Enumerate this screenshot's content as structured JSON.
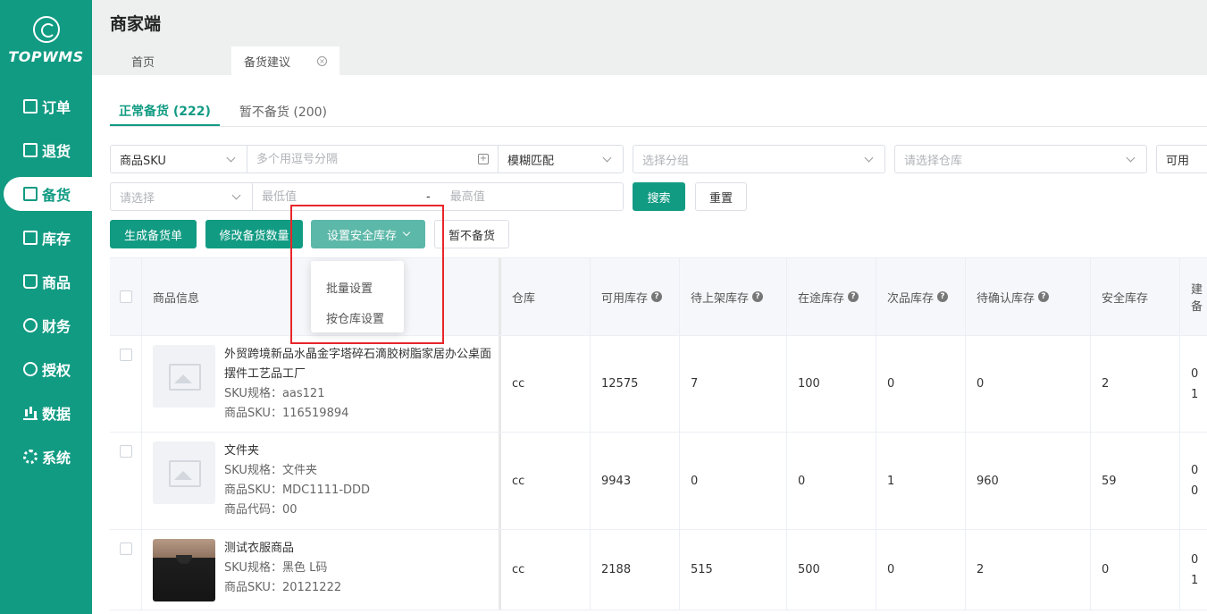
{
  "brand": {
    "name": "TOPWMS"
  },
  "nav": [
    {
      "label": "订单",
      "icon": "order-icon",
      "shape": "box"
    },
    {
      "label": "退货",
      "icon": "return-icon",
      "shape": "box"
    },
    {
      "label": "备货",
      "icon": "stock-prep-icon",
      "shape": "box",
      "active": true
    },
    {
      "label": "库存",
      "icon": "inventory-icon",
      "shape": "box"
    },
    {
      "label": "商品",
      "icon": "goods-icon",
      "shape": "bag"
    },
    {
      "label": "财务",
      "icon": "finance-icon",
      "shape": "circle"
    },
    {
      "label": "授权",
      "icon": "auth-icon",
      "shape": "circle"
    },
    {
      "label": "数据",
      "icon": "data-icon",
      "shape": "bars"
    },
    {
      "label": "系统",
      "icon": "system-icon",
      "shape": "gear"
    }
  ],
  "header": {
    "title": "商家端",
    "tabs": [
      {
        "label": "首页"
      },
      {
        "label": "备货建议",
        "active": true
      }
    ]
  },
  "subtabs": [
    {
      "label": "正常备货 (222)",
      "active": true
    },
    {
      "label": "暂不备货 (200)"
    }
  ],
  "filters": {
    "sku_type": "商品SKU",
    "sku_input_placeholder": "多个用逗号分隔",
    "match_mode": "模糊匹配",
    "group_placeholder": "选择分组",
    "warehouse_placeholder": "请选择仓库",
    "stock_type": "可用",
    "field_placeholder": "请选择",
    "min_placeholder": "最低值",
    "range_sep": "-",
    "max_placeholder": "最高值",
    "search_label": "搜索",
    "reset_label": "重置"
  },
  "actions": {
    "generate": "生成备货单",
    "modify_qty": "修改备货数量",
    "set_safety": "设置安全库存",
    "no_stock": "暂不备货"
  },
  "dropdown": [
    "批量设置",
    "按仓库设置"
  ],
  "accent": "#129b83",
  "table": {
    "headers": {
      "info": "商品信息",
      "warehouse": "仓库",
      "available": "可用库存",
      "to_shelf": "待上架库存",
      "in_transit": "在途库存",
      "defective": "次品库存",
      "to_confirm": "待确认库存",
      "safety": "安全库存",
      "suggest_1": "建",
      "suggest_2": "备"
    },
    "rows": [
      {
        "name": "外贸跨境新品水晶金字塔碎石滴胶树脂家居办公桌面摆件工艺品工厂",
        "spec": "SKU规格：aas121",
        "sku": "商品SKU：116519894",
        "code": "",
        "thumb": "placeholder",
        "warehouse": "cc",
        "available": "12575",
        "to_shelf": "7",
        "in_transit": "100",
        "defective": "0",
        "to_confirm": "0",
        "safety": "2",
        "suggest_1": "0",
        "suggest_2": "1"
      },
      {
        "name": "文件夹",
        "spec": "SKU规格：文件夹",
        "sku": "商品SKU：MDC1111-DDD",
        "code": "商品代码：00",
        "thumb": "placeholder",
        "warehouse": "cc",
        "available": "9943",
        "to_shelf": "0",
        "in_transit": "0",
        "defective": "1",
        "to_confirm": "960",
        "safety": "59",
        "suggest_1": "0",
        "suggest_2": "0"
      },
      {
        "name": "测试衣服商品",
        "spec": "SKU规格：黑色 L码",
        "sku": "商品SKU：20121222",
        "code": "",
        "thumb": "photo",
        "warehouse": "cc",
        "available": "2188",
        "to_shelf": "515",
        "in_transit": "500",
        "defective": "0",
        "to_confirm": "2",
        "safety": "0",
        "suggest_1": "0",
        "suggest_2": "1"
      }
    ]
  }
}
